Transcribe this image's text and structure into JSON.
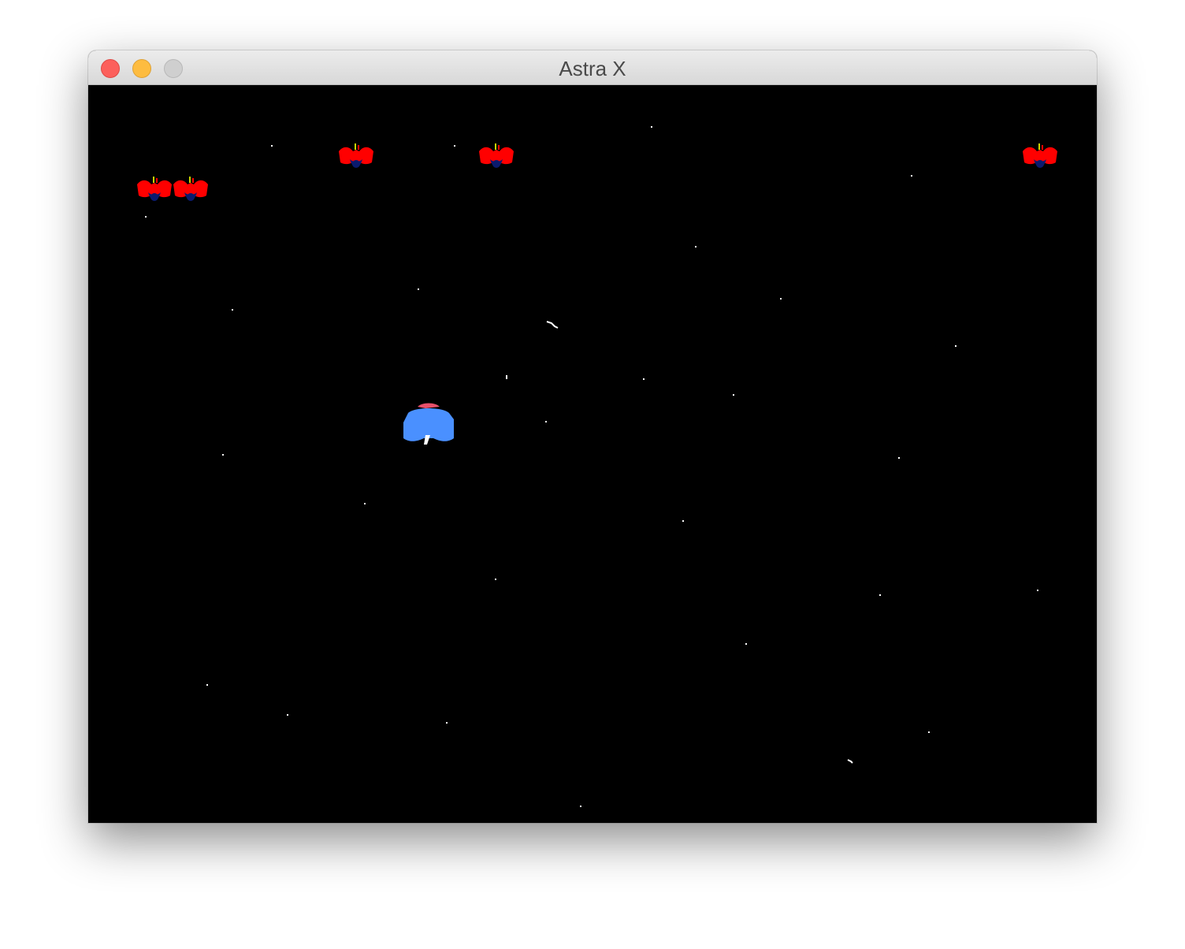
{
  "window": {
    "title": "Astra X",
    "controls": [
      "close",
      "minimize",
      "zoom"
    ]
  },
  "colors": {
    "background": "#000000",
    "titlebar": "#e3e3e3",
    "enemy_body": "#ff0000",
    "enemy_core": "#0a1a6e",
    "enemy_antenna": "#c8d400",
    "player_body": "#4a90ff",
    "player_cockpit": "#e8506a",
    "star": "#ffffff"
  },
  "game": {
    "enemies": [
      "enemy",
      "enemy",
      "enemy",
      "enemy",
      "enemy"
    ],
    "player": "player-ship",
    "icons": [
      "enemy-ship-icon",
      "player-ship-icon",
      "star-icon",
      "projectile-icon"
    ]
  }
}
